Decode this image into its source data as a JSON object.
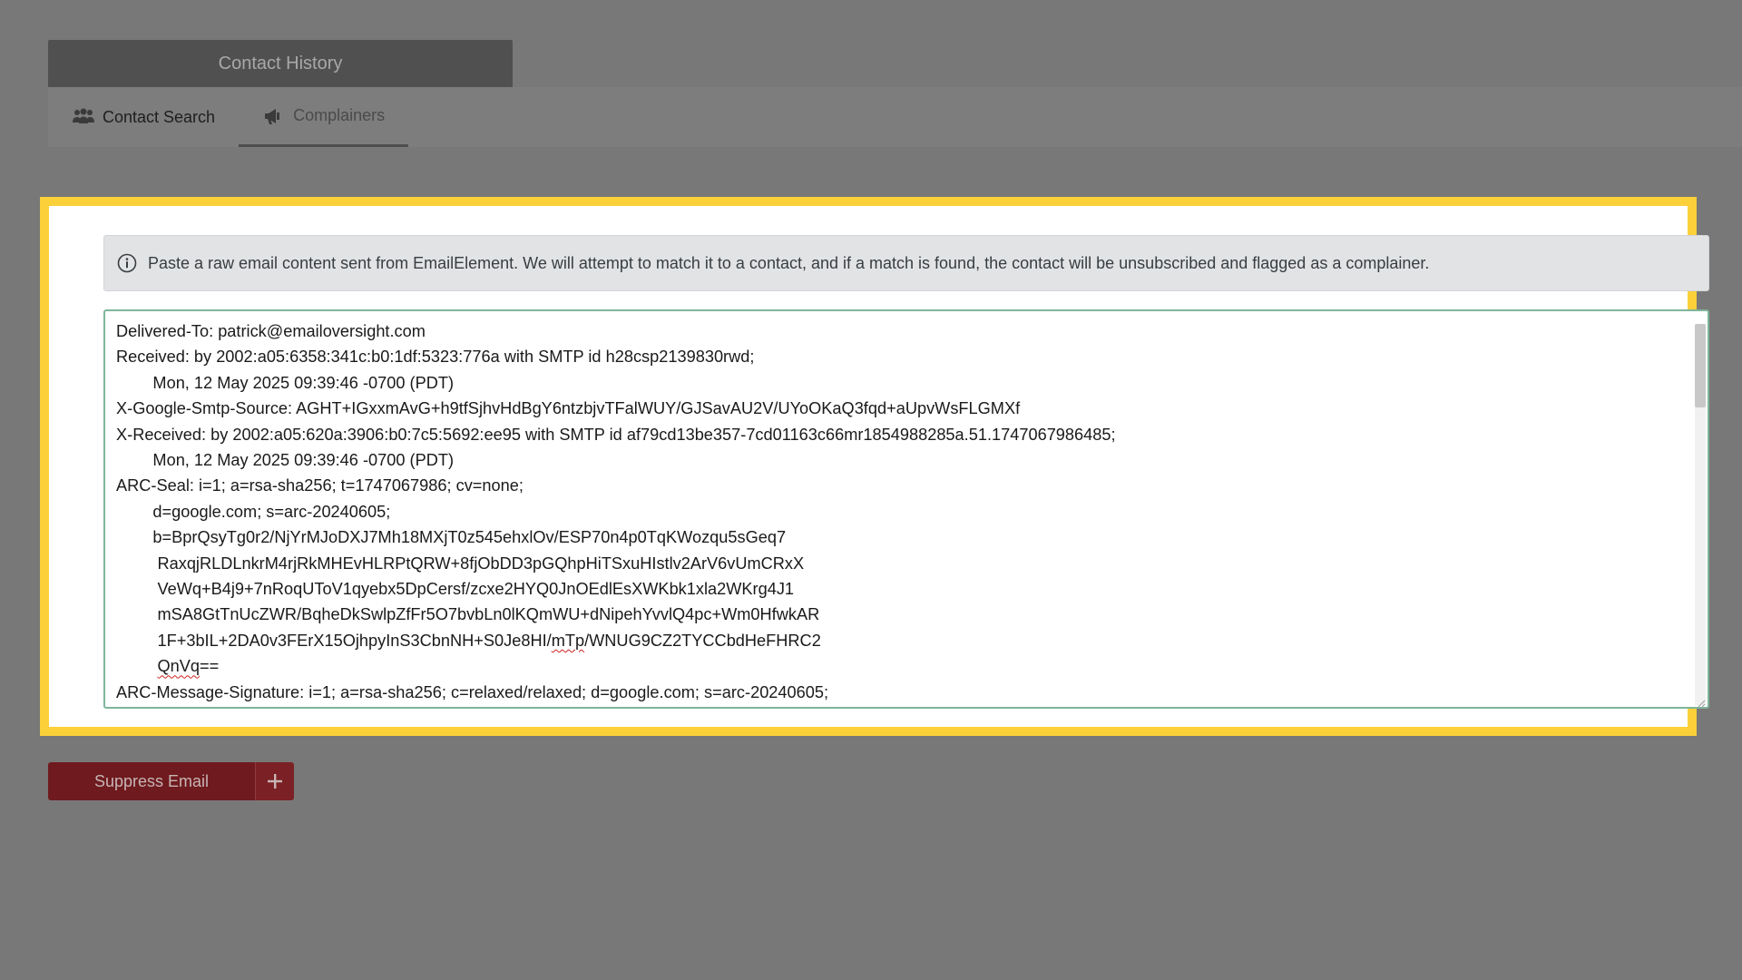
{
  "header": {
    "title": "Contact History"
  },
  "tabs": [
    {
      "label": "Contact Search",
      "icon": "users-icon"
    },
    {
      "label": "Complainers",
      "icon": "megaphone-icon"
    }
  ],
  "info_alert": {
    "icon": "info-circle-icon",
    "text": "Paste a raw email content sent from EmailElement. We will attempt to match it to a contact, and if a match is found, the contact will be unsubscribed and flagged as a complainer."
  },
  "raw_email": {
    "lines": [
      "Delivered-To: patrick@emailoversight.com",
      "Received: by 2002:a05:6358:341c:b0:1df:5323:776a with SMTP id h28csp2139830rwd;",
      "        Mon, 12 May 2025 09:39:46 -0700 (PDT)",
      "X-Google-Smtp-Source: AGHT+IGxxmAvG+h9tfSjhvHdBgY6ntzbjvTFalWUY/GJSavAU2V/UYoOKaQ3fqd+aUpvWsFLGMXf",
      "X-Received: by 2002:a05:620a:3906:b0:7c5:5692:ee95 with SMTP id af79cd13be357-7cd01163c66mr1854988285a.51.1747067986485;",
      "        Mon, 12 May 2025 09:39:46 -0700 (PDT)",
      "ARC-Seal: i=1; a=rsa-sha256; t=1747067986; cv=none;",
      "        d=google.com; s=arc-20240605;",
      "        b=BprQsyTg0r2/NjYrMJoDXJ7Mh18MXjT0z545ehxlOv/ESP70n4p0TqKWozqu5sGeq7",
      "         RaxqjRLDLnkrM4rjRkMHEvHLRPtQRW+8fjObDD3pGQhpHiTSxuHIstlv2ArV6vUmCRxX",
      "         VeWq+B4j9+7nRoqUToV1qyebx5DpCersf/zcxe2HYQ0JnOEdlEsXWKbk1xla2WKrg4J1",
      "         mSA8GtTnUcZWR/BqheDkSwlpZfFr5O7bvbLn0lKQmWU+dNipehYvvlQ4pc+Wm0HfwkAR",
      "         1F+3bIL+2DA0v3FErX15OjhpyInS3CbnNH+S0Je8HI/mTp/WNUG9CZ2TYCCbdHeFHRC2",
      "         QnVq==",
      "ARC-Message-Signature: i=1; a=rsa-sha256; c=relaxed/relaxed; d=google.com; s=arc-20240605;"
    ]
  },
  "actions": {
    "suppress_label": "Suppress Email",
    "add_icon": "plus-icon"
  },
  "colors": {
    "highlight": "#fbd039",
    "suppress_button": "#6e1a1e",
    "textarea_border": "#7fb59a"
  }
}
